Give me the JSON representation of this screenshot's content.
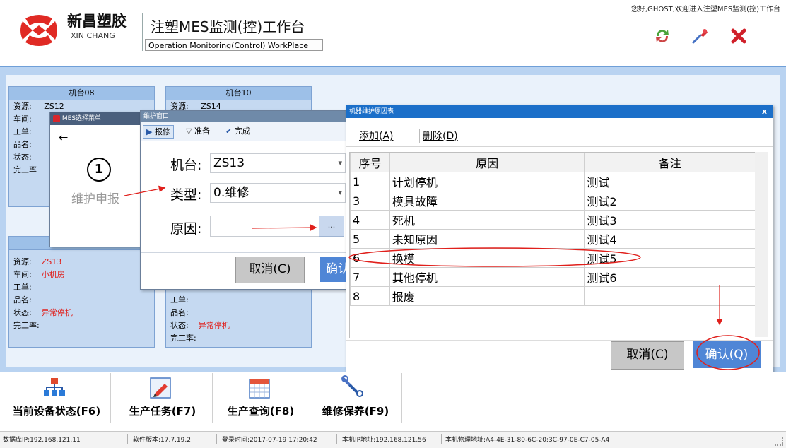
{
  "header": {
    "brand_name": "新昌塑胶",
    "brand_sub": "XIN CHANG",
    "app_title": "注塑MES监测(控)工作台",
    "app_sub": "Operation Monitoring(Control) WorkPlace",
    "welcome": "您好,GHOST,欢迎进入注塑MES监测(控)工作台"
  },
  "machines": [
    {
      "title": "机台08",
      "rows": [
        {
          "label": "资源:",
          "value": "ZS12"
        },
        {
          "label": "车间:",
          "value": ""
        },
        {
          "label": "工单:",
          "value": ""
        },
        {
          "label": "品名:",
          "value": ""
        },
        {
          "label": "状态:",
          "value": ""
        },
        {
          "label": "完工率",
          "value": ""
        }
      ]
    },
    {
      "title": "机台10",
      "rows": [
        {
          "label": "资源:",
          "value": "ZS14"
        }
      ]
    },
    {
      "title": "",
      "rows": [
        {
          "label": "资源:",
          "value": "ZS13"
        },
        {
          "label": "车间:",
          "value": "小机房"
        },
        {
          "label": "工单:",
          "value": ""
        },
        {
          "label": "品名:",
          "value": ""
        },
        {
          "label": "状态:",
          "value": "异常停机"
        },
        {
          "label": "完工率:",
          "value": ""
        }
      ]
    },
    {
      "title": "",
      "rows": [
        {
          "label": "工单:",
          "value": ""
        },
        {
          "label": "品名:",
          "value": ""
        },
        {
          "label": "状态:",
          "value": "异常停机"
        },
        {
          "label": "完工率:",
          "value": ""
        }
      ]
    }
  ],
  "mes_dialog": {
    "title": "MES选择菜单",
    "back_icon": "back-arrow-icon",
    "step": "1",
    "menu_label": "维护申报"
  },
  "repair_window": {
    "title": "维护窗口",
    "tabs": [
      "报修",
      "准备",
      "完成"
    ],
    "machine_label": "机台:",
    "machine_value": "ZS13",
    "type_label": "类型:",
    "type_value": "0.维修",
    "reason_label": "原因:",
    "reason_value": "",
    "browse_label": "...",
    "cancel_label": "取消(C)",
    "confirm_label": "确认"
  },
  "reason_dialog": {
    "title": "机器维护原因表",
    "close_label": "x",
    "add_label": "添加(A)",
    "delete_label": "删除(D)",
    "columns": [
      "序号",
      "原因",
      "备注"
    ],
    "rows": [
      {
        "no": "1",
        "reason": "计划停机",
        "note": "测试"
      },
      {
        "no": "3",
        "reason": "模具故障",
        "note": "测试2"
      },
      {
        "no": "4",
        "reason": "死机",
        "note": "测试3"
      },
      {
        "no": "5",
        "reason": "未知原因",
        "note": "测试4"
      },
      {
        "no": "6",
        "reason": "换模",
        "note": "测试5"
      },
      {
        "no": "7",
        "reason": "其他停机",
        "note": "测试6"
      },
      {
        "no": "8",
        "reason": "报废",
        "note": ""
      }
    ],
    "cancel_label": "取消(C)",
    "confirm_label": "确认(Q)"
  },
  "nav": [
    {
      "label": "当前设备状态(F6)",
      "icon": "network-icon"
    },
    {
      "label": "生产任务(F7)",
      "icon": "pencil-icon"
    },
    {
      "label": "生产查询(F8)",
      "icon": "calendar-icon"
    },
    {
      "label": "维修保养(F9)",
      "icon": "wrench-icon"
    }
  ],
  "statusbar": [
    "数据库IP:192.168.121.11",
    "软件版本:17.7.19.2",
    "登录时间:2017-07-19 17:20:42",
    "本机IP地址:192.168.121.56",
    "本机物理地址:A4-4E-31-80-6C-20;3C-97-0E-C7-05-A4"
  ],
  "colors": {
    "accent": "#4f86d6",
    "alert": "#e0201c",
    "workspace": "#b9d3f1"
  }
}
